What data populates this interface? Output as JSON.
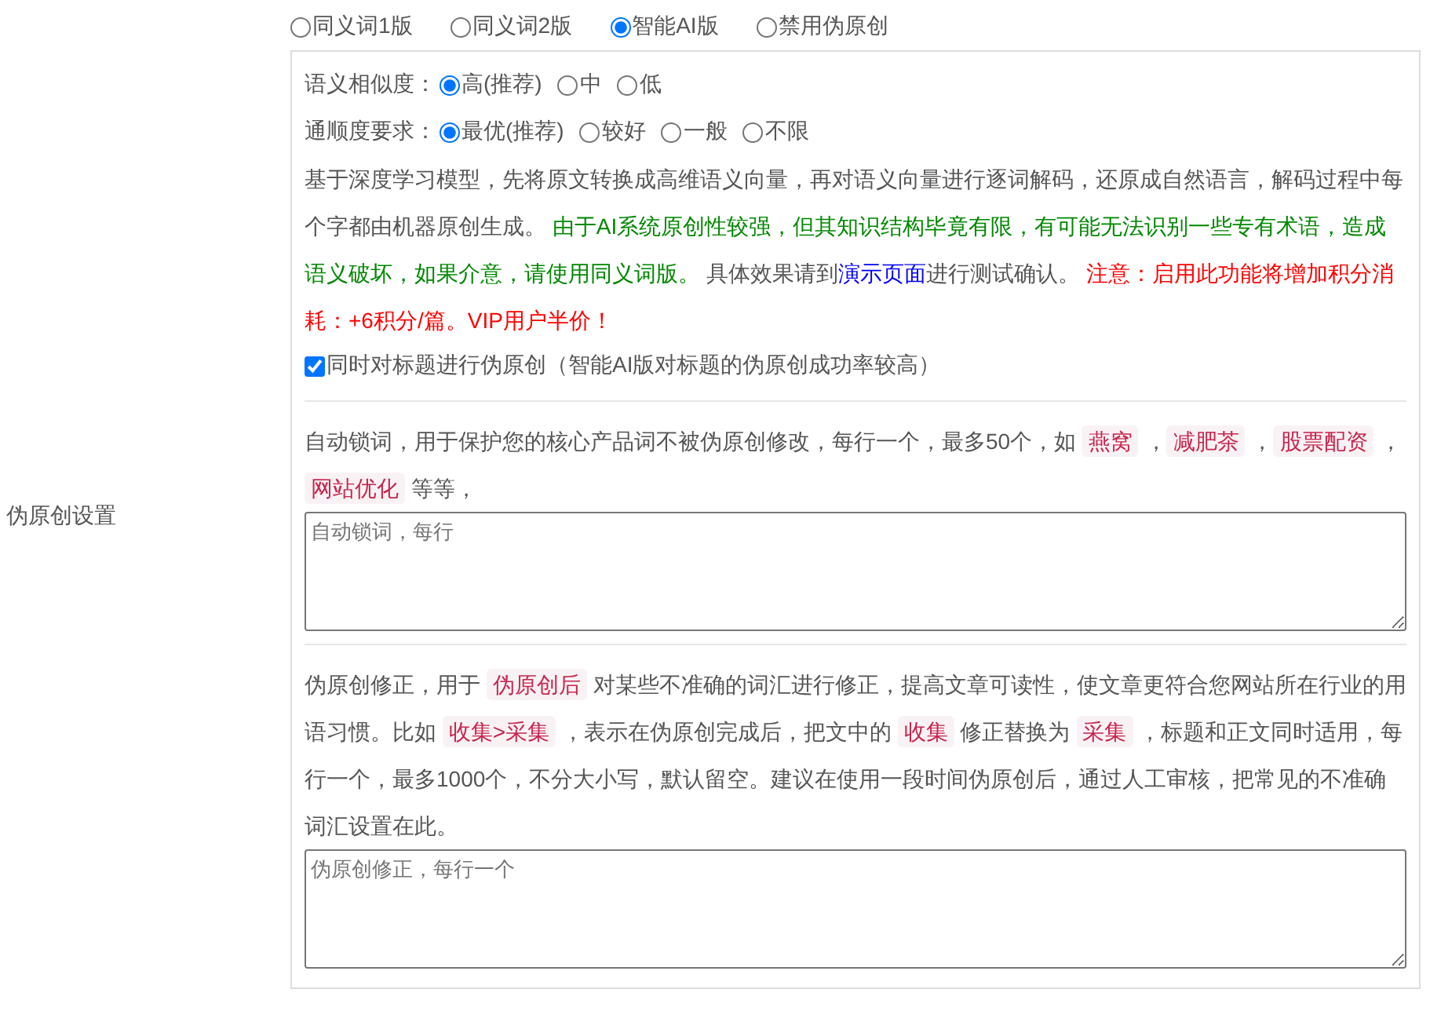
{
  "section_label": "伪原创设置",
  "mode_options": [
    {
      "label": "同义词1版",
      "selected": false
    },
    {
      "label": "同义词2版",
      "selected": false
    },
    {
      "label": "智能AI版",
      "selected": true
    },
    {
      "label": "禁用伪原创",
      "selected": false
    }
  ],
  "ai_panel": {
    "settings": [
      {
        "label": "语义相似度：",
        "options": [
          {
            "label": "高(推荐)",
            "selected": true
          },
          {
            "label": "中",
            "selected": false
          },
          {
            "label": "低",
            "selected": false
          }
        ]
      },
      {
        "label": "通顺度要求：",
        "options": [
          {
            "label": "最优(推荐)",
            "selected": true
          },
          {
            "label": "较好",
            "selected": false
          },
          {
            "label": "一般",
            "selected": false
          },
          {
            "label": "不限",
            "selected": false
          }
        ]
      }
    ],
    "description": [
      {
        "kind": "text",
        "text": "基于深度学习模型，先将原文转换成高维语义向量，再对语义向量进行逐词解码，还原成自然语言，解码过程中每个字都由机器原创生成。 "
      },
      {
        "kind": "green",
        "text": "由于AI系统原创性较强，但其知识结构毕竟有限，有可能无法识别一些专有术语，造成语义破坏，如果介意，请使用同义词版。"
      },
      {
        "kind": "text",
        "text": " 具体效果请到"
      },
      {
        "kind": "link",
        "text": "演示页面"
      },
      {
        "kind": "text",
        "text": "进行测试确认。 "
      },
      {
        "kind": "red",
        "text": "注意：启用此功能将增加积分消耗：+6积分/篇。VIP用户半价！"
      }
    ],
    "title_checkbox": {
      "label": "同时对标题进行伪原创（智能AI版对标题的伪原创成功率较高）",
      "checked": true
    }
  },
  "lock_words": {
    "description": [
      {
        "kind": "text",
        "text": "自动锁词，用于保护您的核心产品词不被伪原创修改，每行一个，最多50个，如 "
      },
      {
        "kind": "code",
        "text": "燕窝"
      },
      {
        "kind": "text",
        "text": " ，"
      },
      {
        "kind": "code",
        "text": "减肥茶"
      },
      {
        "kind": "text",
        "text": " ，"
      },
      {
        "kind": "code",
        "text": "股票配资"
      },
      {
        "kind": "text",
        "text": " ，"
      },
      {
        "kind": "code",
        "text": "网站优化"
      },
      {
        "kind": "text",
        "text": " 等等，"
      }
    ],
    "placeholder": "自动锁词，每行"
  },
  "corrections": {
    "description": [
      {
        "kind": "text",
        "text": "伪原创修正，用于 "
      },
      {
        "kind": "code",
        "text": "伪原创后"
      },
      {
        "kind": "text",
        "text": " 对某些不准确的词汇进行修正，提高文章可读性，使文章更符合您网站所在行业的用语习惯。比如 "
      },
      {
        "kind": "code",
        "text": "收集>采集"
      },
      {
        "kind": "text",
        "text": " ，表示在伪原创完成后，把文中的 "
      },
      {
        "kind": "code",
        "text": "收集"
      },
      {
        "kind": "text",
        "text": " 修正替换为 "
      },
      {
        "kind": "code",
        "text": "采集"
      },
      {
        "kind": "text",
        "text": " ，标题和正文同时适用，每行一个，最多1000个，不分大小写，默认留空。建议在使用一段时间伪原创后，通过人工审核，把常见的不准确词汇设置在此。"
      }
    ],
    "placeholder": "伪原创修正，每行一个"
  }
}
